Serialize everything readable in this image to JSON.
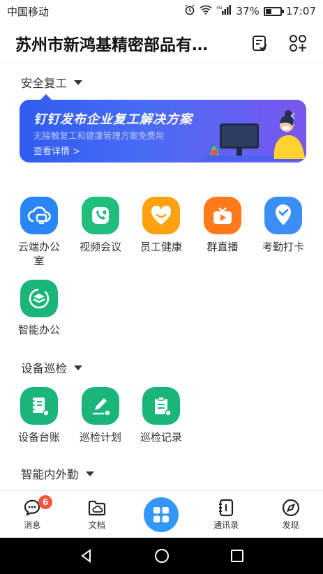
{
  "status": {
    "carrier": "中国移动",
    "battery": "37%",
    "time": "17:07",
    "network": "4G"
  },
  "header": {
    "org_name": "苏州市新鸿基精密部品有…"
  },
  "sections": {
    "safety": "安全复工",
    "inspection": "设备巡检",
    "field": "智能内外勤"
  },
  "banner": {
    "title": "钉钉发布企业复工解决方案",
    "subtitle": "无接触复工和健康管理方案免费用",
    "link": "查看详情 >"
  },
  "apps": [
    {
      "label": "云端办公室",
      "color": "#2b86f5",
      "icon": "cloud-office-icon"
    },
    {
      "label": "视频会议",
      "color": "#1fbe7d",
      "icon": "video-call-icon"
    },
    {
      "label": "员工健康",
      "color": "#ffa111",
      "icon": "heart-smile-icon"
    },
    {
      "label": "群直播",
      "color": "#ff7a1a",
      "icon": "tv-live-icon"
    },
    {
      "label": "考勤打卡",
      "color": "#3b8ef7",
      "icon": "location-check-icon"
    },
    {
      "label": "智能办公",
      "color": "#19b57a",
      "icon": "layers-icon"
    }
  ],
  "inspection_apps": [
    {
      "label": "设备台账",
      "color": "#19b57a",
      "icon": "ledger-icon"
    },
    {
      "label": "巡检计划",
      "color": "#19b57a",
      "icon": "pen-plan-icon"
    },
    {
      "label": "巡检记录",
      "color": "#19b57a",
      "icon": "clipboard-icon"
    }
  ],
  "tabs": [
    {
      "label": "消息",
      "badge": "6"
    },
    {
      "label": "文档"
    },
    {
      "label": ""
    },
    {
      "label": "通讯录"
    },
    {
      "label": "发现"
    }
  ]
}
